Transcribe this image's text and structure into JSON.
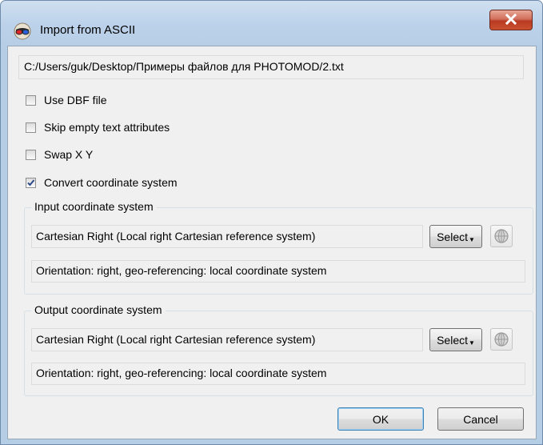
{
  "window": {
    "title": "Import from ASCII"
  },
  "file_path": "C:/Users/guk/Desktop/Примеры файлов для PHOTOMOD/2.txt",
  "options": [
    {
      "label": "Use DBF file",
      "checked": false
    },
    {
      "label": "Skip empty text attributes",
      "checked": false
    },
    {
      "label": "Swap X Y",
      "checked": false
    },
    {
      "label": "Convert coordinate system",
      "checked": true
    }
  ],
  "input_cs": {
    "group_title": "Input coordinate system",
    "value": "Cartesian Right (Local right Cartesian reference system)",
    "select_label": "Select",
    "info": "Orientation: right, geo-referencing: local coordinate system"
  },
  "output_cs": {
    "group_title": "Output coordinate system",
    "value": "Cartesian Right (Local right Cartesian reference system)",
    "select_label": "Select",
    "info": "Orientation: right, geo-referencing: local coordinate system"
  },
  "buttons": {
    "ok": "OK",
    "cancel": "Cancel"
  },
  "icons": {
    "app": "glasses-globe-icon",
    "close": "close-icon",
    "globe": "globe-icon",
    "dropdown": "dropdown-arrow-icon",
    "check": "checkmark-icon"
  },
  "colors": {
    "title_bar": "#bcd2ea",
    "close_button": "#c9502f",
    "dialog_bg": "#f0f0f0",
    "default_button_border": "#3c7fb1"
  }
}
